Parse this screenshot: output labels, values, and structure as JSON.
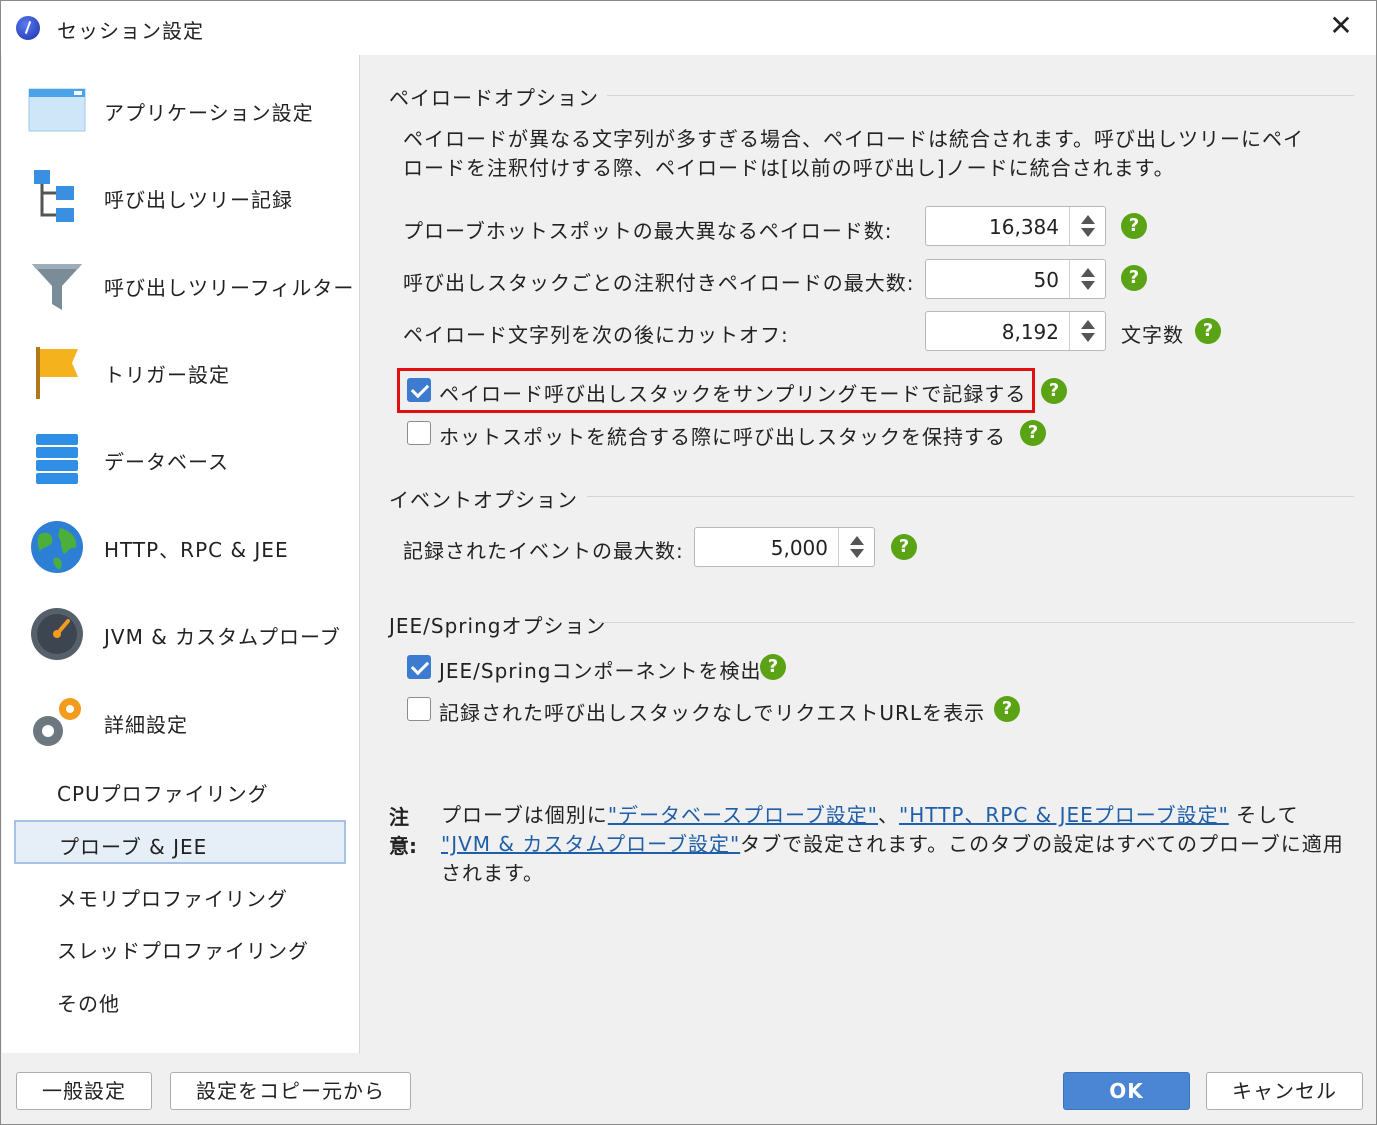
{
  "window": {
    "title": "セッション設定",
    "close_glyph": "✕"
  },
  "sidebar": {
    "items": [
      {
        "label": "アプリケーション設定",
        "icon": "application-window-icon"
      },
      {
        "label": "呼び出しツリー記録",
        "icon": "call-tree-icon"
      },
      {
        "label": "呼び出しツリーフィルター",
        "icon": "funnel-icon"
      },
      {
        "label": "トリガー設定",
        "icon": "flag-icon"
      },
      {
        "label": "データベース",
        "icon": "database-icon"
      },
      {
        "label": "HTTP、RPC & JEE",
        "icon": "globe-icon"
      },
      {
        "label": "JVM & カスタムプローブ",
        "icon": "gauge-icon"
      },
      {
        "label": "詳細設定",
        "icon": "gears-icon"
      }
    ],
    "sub_items": [
      {
        "label": "CPUプロファイリング"
      },
      {
        "label": "プローブ & JEE",
        "selected": true
      },
      {
        "label": "メモリプロファイリング"
      },
      {
        "label": "スレッドプロファイリング"
      },
      {
        "label": "その他"
      }
    ]
  },
  "payload": {
    "section_title": "ペイロードオプション",
    "description": "ペイロードが異なる文字列が多すぎる場合、ペイロードは統合されます。呼び出しツリーにペイロードを注釈付けする際、ペイロードは[以前の呼び出し]ノードに統合されます。",
    "max_hotspot_label": "プローブホットスポットの最大異なるペイロード数:",
    "max_hotspot_value": "16,384",
    "max_annotated_label": "呼び出しスタックごとの注釈付きペイロードの最大数:",
    "max_annotated_value": "50",
    "cutoff_label": "ペイロード文字列を次の後にカットオフ:",
    "cutoff_value": "8,192",
    "cutoff_unit": "文字数",
    "record_sampling_label": "ペイロード呼び出しスタックをサンプリングモードで記録する",
    "record_sampling_checked": true,
    "retain_stacks_label": "ホットスポットを統合する際に呼び出しスタックを保持する",
    "retain_stacks_checked": false
  },
  "event": {
    "section_title": "イベントオプション",
    "max_events_label": "記録されたイベントの最大数:",
    "max_events_value": "5,000"
  },
  "jee": {
    "section_title": "JEE/Springオプション",
    "detect_label": "JEE/Springコンポーネントを検出",
    "detect_checked": true,
    "show_url_label": "記録された呼び出しスタックなしでリクエストURLを表示",
    "show_url_checked": false
  },
  "note": {
    "heading": "注意:",
    "text_1": "プローブは個別に",
    "link_1": "\"データベースプローブ設定\"",
    "text_2": "、",
    "link_2": "\"HTTP、RPC & JEEプローブ設定\"",
    "text_3": " そして ",
    "link_3": "\"JVM & カスタムプローブ設定\"",
    "text_4": "タブで設定されます。このタブの設定はすべてのプローブに適用されます。"
  },
  "help_glyph": "?",
  "buttons": {
    "general": "一般設定",
    "copy_from": "設定をコピー元から",
    "ok": "OK",
    "cancel": "キャンセル"
  },
  "colors": {
    "accent": "#4a86d4",
    "help": "#5aa315",
    "highlight": "#e01010",
    "link": "#1f5ea8"
  }
}
